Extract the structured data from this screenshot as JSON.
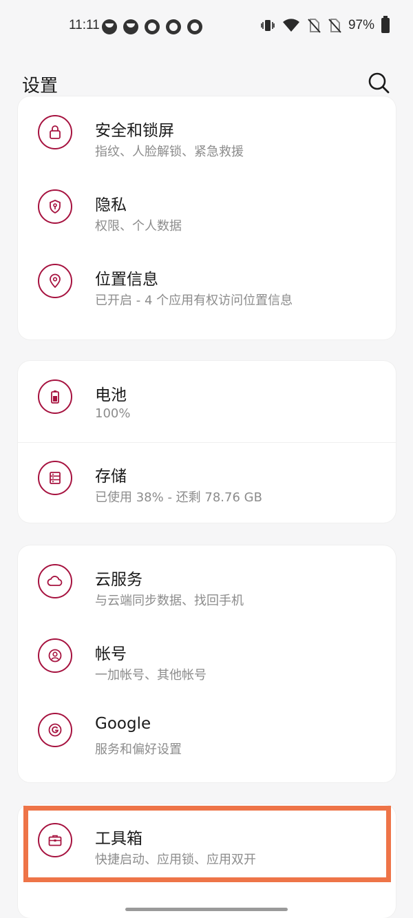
{
  "status_bar": {
    "time": "11:11",
    "notification_icons": [
      "app-icon",
      "app-icon",
      "q-icon",
      "q-icon",
      "q-icon"
    ],
    "system_icons": [
      "vibrate-icon",
      "wifi-icon",
      "no-sim-icon",
      "no-sim-icon"
    ],
    "battery_percent": "97%"
  },
  "header": {
    "title": "设置",
    "search_icon": "search-icon"
  },
  "accent_color": "#a6123f",
  "groups": [
    {
      "items": [
        {
          "icon": "lock-icon",
          "title": "安全和锁屏",
          "subtitle": "指纹、人脸解锁、紧急救援"
        },
        {
          "icon": "privacy-shield-icon",
          "title": "隐私",
          "subtitle": "权限、个人数据"
        },
        {
          "icon": "location-pin-icon",
          "title": "位置信息",
          "subtitle": "已开启 - 4 个应用有权访问位置信息"
        }
      ]
    },
    {
      "items": [
        {
          "icon": "battery-icon",
          "title": "电池",
          "subtitle": "100%"
        },
        {
          "icon": "storage-icon",
          "title": "存储",
          "subtitle": "已使用 38% - 还剩 78.76 GB"
        }
      ]
    },
    {
      "items": [
        {
          "icon": "cloud-icon",
          "title": "云服务",
          "subtitle": "与云端同步数据、找回手机"
        },
        {
          "icon": "account-icon",
          "title": "帐号",
          "subtitle": "一加帐号、其他帐号"
        },
        {
          "icon": "google-icon",
          "title": "Google",
          "subtitle": "服务和偏好设置"
        }
      ]
    },
    {
      "items": [
        {
          "icon": "toolbox-icon",
          "title": "工具箱",
          "subtitle": "快捷启动、应用锁、应用双开"
        }
      ]
    }
  ]
}
